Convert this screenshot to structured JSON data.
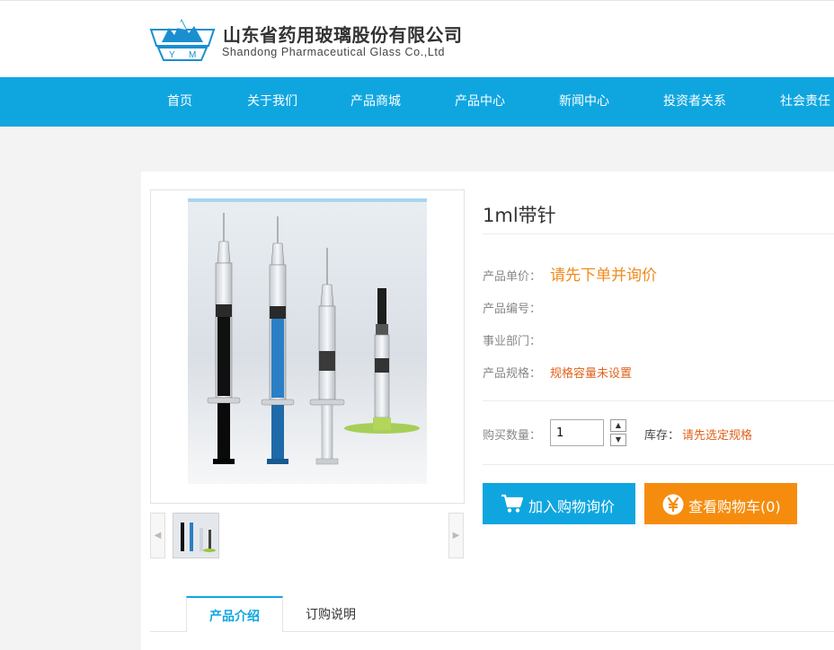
{
  "brand": {
    "name_cn": "山东省药用玻璃股份有限公司",
    "name_en": "Shandong Pharmaceutical Glass Co.,Ltd",
    "logo_letters": "Y M"
  },
  "nav": {
    "items": [
      "首页",
      "关于我们",
      "产品商城",
      "产品中心",
      "新闻中心",
      "投资者关系",
      "社会责任"
    ]
  },
  "product": {
    "title": "1ml带针",
    "price_label": "产品单价：",
    "price_value": "请先下单并询价",
    "code_label": "产品编号：",
    "dept_label": "事业部门：",
    "spec_label": "产品规格：",
    "spec_value": "规格容量未设置",
    "qty_label": "购买数量：",
    "qty_value": "1",
    "stock_label": "库存：",
    "stock_value": "请先选定规格"
  },
  "buttons": {
    "add_cart": "加入购物询价",
    "view_cart": "查看购物车(0)"
  },
  "tabs": [
    "产品介绍",
    "订购说明"
  ],
  "colors": {
    "nav_blue": "#0fa6e0",
    "price_orange": "#f08a1c",
    "spec_orange": "#e2621b",
    "cart_orange": "#f68c0e"
  },
  "icons": {
    "cart": "shopping-cart-icon",
    "yen": "yen-circle-icon",
    "prev": "chevron-left-icon",
    "next": "chevron-right-icon",
    "up": "caret-up-icon",
    "down": "caret-down-icon"
  }
}
